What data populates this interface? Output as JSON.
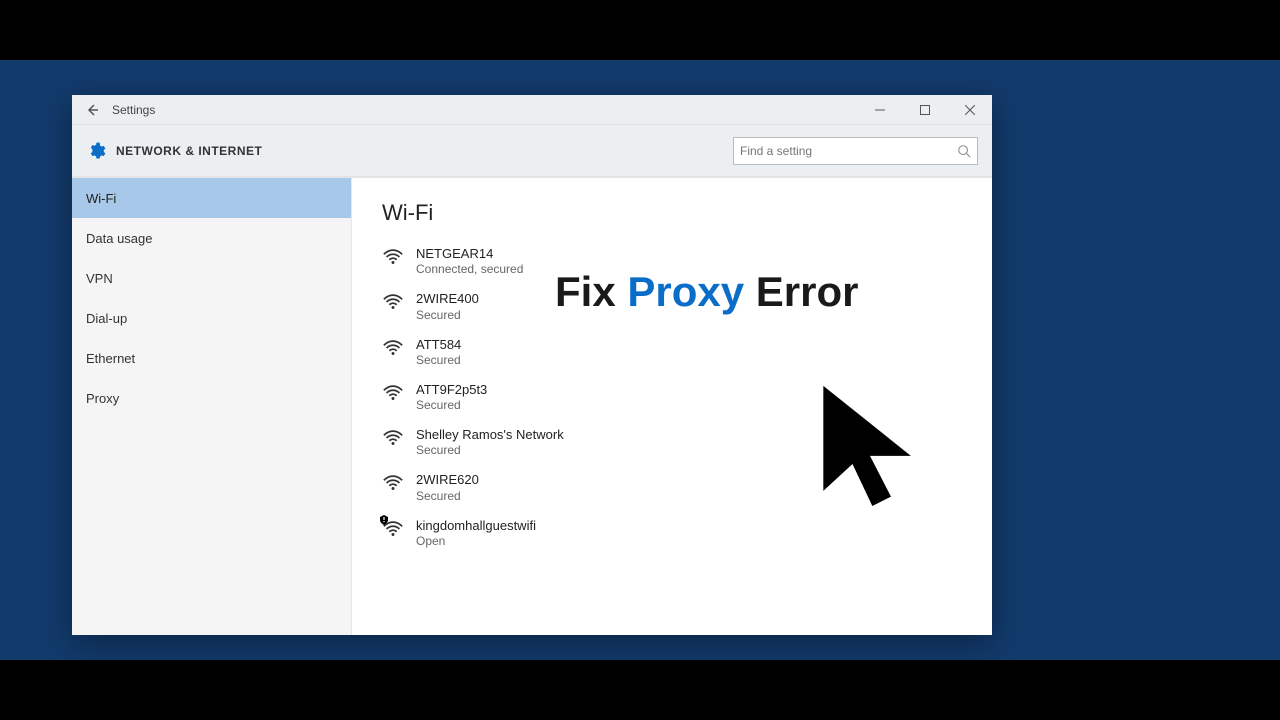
{
  "window": {
    "app_name": "Settings",
    "category": "NETWORK & INTERNET",
    "search_placeholder": "Find a setting"
  },
  "sidebar": {
    "items": [
      {
        "label": "Wi-Fi",
        "selected": true
      },
      {
        "label": "Data usage",
        "selected": false
      },
      {
        "label": "VPN",
        "selected": false
      },
      {
        "label": "Dial-up",
        "selected": false
      },
      {
        "label": "Ethernet",
        "selected": false
      },
      {
        "label": "Proxy",
        "selected": false
      }
    ]
  },
  "main": {
    "page_title": "Wi-Fi",
    "networks": [
      {
        "ssid": "NETGEAR14",
        "status": "Connected, secured",
        "open": false
      },
      {
        "ssid": "2WIRE400",
        "status": "Secured",
        "open": false
      },
      {
        "ssid": "ATT584",
        "status": "Secured",
        "open": false
      },
      {
        "ssid": "ATT9F2p5t3",
        "status": "Secured",
        "open": false
      },
      {
        "ssid": "Shelley Ramos's Network",
        "status": "Secured",
        "open": false
      },
      {
        "ssid": "2WIRE620",
        "status": "Secured",
        "open": false
      },
      {
        "ssid": "kingdomhallguestwifi",
        "status": "Open",
        "open": true
      }
    ]
  },
  "overlay": {
    "part1": "Fix ",
    "accent": "Proxy",
    "part2": " Error"
  }
}
